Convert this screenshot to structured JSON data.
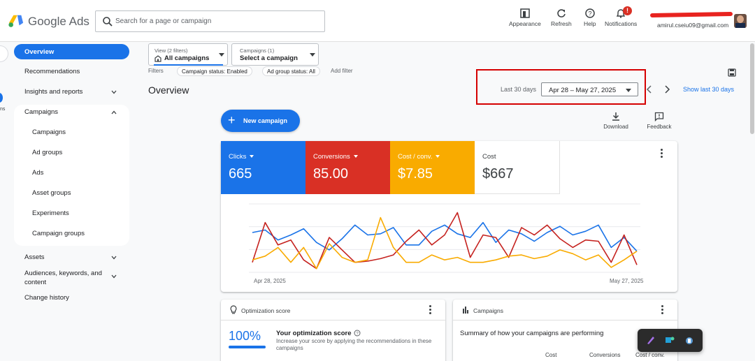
{
  "app": {
    "brand": "Google Ads"
  },
  "search": {
    "placeholder": "Search for a page or campaign"
  },
  "header": {
    "appearance": "Appearance",
    "refresh": "Refresh",
    "help": "Help",
    "notifications": "Notifications",
    "notification_count": "!",
    "account_email": "amirul.cseiu09@gmail.com"
  },
  "sidebar": {
    "items": [
      {
        "label": "Overview"
      },
      {
        "label": "Recommendations"
      },
      {
        "label": "Insights and reports"
      },
      {
        "label": "Campaigns"
      },
      {
        "label": "Campaigns"
      },
      {
        "label": "Ad groups"
      },
      {
        "label": "Ads"
      },
      {
        "label": "Asset groups"
      },
      {
        "label": "Experiments"
      },
      {
        "label": "Campaign groups"
      },
      {
        "label": "Assets"
      },
      {
        "label": "Audiences, keywords, and"
      },
      {
        "label": "content"
      },
      {
        "label": "Change history"
      }
    ],
    "rail_text": "ns"
  },
  "view_filter": {
    "small": "View (2 filters)",
    "value": "All campaigns"
  },
  "campaign_filter": {
    "small": "Campaigns (1)",
    "value": "Select a campaign"
  },
  "filters": {
    "label": "Filters",
    "chips": [
      "Campaign status: Enabled",
      "Ad group status: All"
    ],
    "add": "Add filter"
  },
  "page": {
    "title": "Overview"
  },
  "date": {
    "preset": "Last 30 days",
    "range": "Apr 28 – May 27, 2025",
    "show_last": "Show last 30 days"
  },
  "actions": {
    "new_campaign": "New campaign",
    "download": "Download",
    "feedback": "Feedback"
  },
  "metrics": [
    {
      "label": "Clicks",
      "value": "665",
      "bg": "#1a73e8",
      "fg": "#ffffff"
    },
    {
      "label": "Conversions",
      "value": "85.00",
      "bg": "#d93025",
      "fg": "#ffffff"
    },
    {
      "label": "Cost / conv.",
      "value": "$7.85",
      "bg": "#f9ab00",
      "fg": "#ffffff"
    },
    {
      "label": "Cost",
      "value": "$667",
      "bg": "#ffffff",
      "fg": "#3c4043"
    }
  ],
  "chart_data": {
    "type": "line",
    "x_start": "Apr 28, 2025",
    "x_end": "May 27, 2025",
    "series": [
      {
        "color": "#1a73e8",
        "values": [
          32,
          34,
          26,
          30,
          35,
          24,
          18,
          27,
          38,
          30,
          31,
          36,
          22,
          22,
          33,
          38,
          31,
          28,
          40,
          24,
          34,
          31,
          25,
          32,
          37,
          30,
          33,
          38,
          20,
          28,
          17
        ]
      },
      {
        "color": "#c5221f",
        "values": [
          8,
          40,
          22,
          26,
          10,
          3,
          28,
          18,
          8,
          9,
          11,
          14,
          25,
          34,
          22,
          30,
          48,
          12,
          30,
          28,
          12,
          36,
          30,
          38,
          27,
          20,
          26,
          25,
          8,
          30,
          6
        ]
      },
      {
        "color": "#f9ab00",
        "values": [
          10,
          13,
          20,
          8,
          20,
          3,
          23,
          12,
          8,
          10,
          44,
          20,
          8,
          8,
          14,
          10,
          12,
          8,
          8,
          10,
          13,
          14,
          11,
          13,
          18,
          15,
          10,
          14,
          4,
          10,
          17
        ]
      }
    ],
    "ylim": [
      0,
      55
    ]
  },
  "optimization": {
    "title": "Optimization score",
    "score": "100%",
    "heading": "Your optimization score",
    "description": "Increase your score by applying the recommendations in these campaigns"
  },
  "campaigns_card": {
    "title": "Campaigns",
    "summary": "Summary of how your campaigns are performing",
    "columns": [
      "Cost",
      "Conversions",
      "Cost / conv."
    ]
  }
}
